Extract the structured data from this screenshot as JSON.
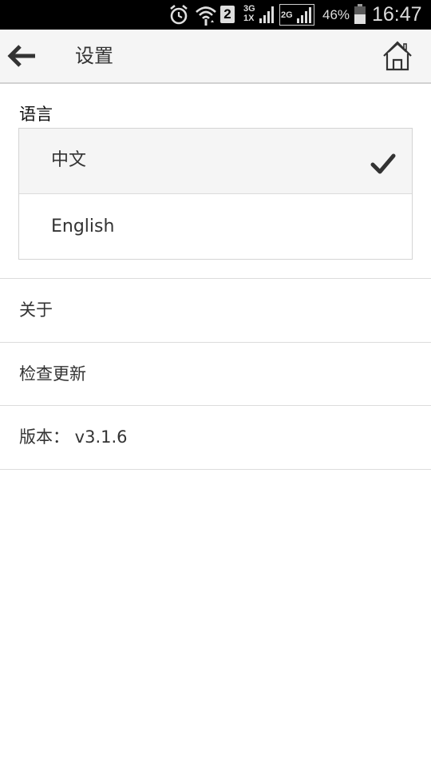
{
  "status_bar": {
    "net_3g_label": "3G",
    "net_1x_label": "1X",
    "net_2g_label": "2G",
    "sim_slot": "2",
    "battery_percent": "46%",
    "time": "16:47",
    "icons": [
      "alarm-icon",
      "wifi-icon",
      "sim-2-icon",
      "signal-3g-icon",
      "signal-2g-icon",
      "battery-icon"
    ]
  },
  "header": {
    "title": "设置",
    "back_icon": "arrow-left-icon",
    "home_icon": "home-icon"
  },
  "language": {
    "section_label": "语言",
    "options": [
      {
        "label": "中文",
        "selected": true
      },
      {
        "label": "English",
        "selected": false
      }
    ],
    "selected_icon": "checkmark-icon"
  },
  "menu": {
    "about_label": "关于",
    "check_update_label": "检查更新",
    "version_label": "版本： v3.1.6"
  },
  "colors": {
    "status_bar_bg": "#000000",
    "header_bg": "#f5f5f5",
    "selected_bg": "#f5f5f5",
    "divider": "#dcdcdc",
    "text": "#333333"
  }
}
